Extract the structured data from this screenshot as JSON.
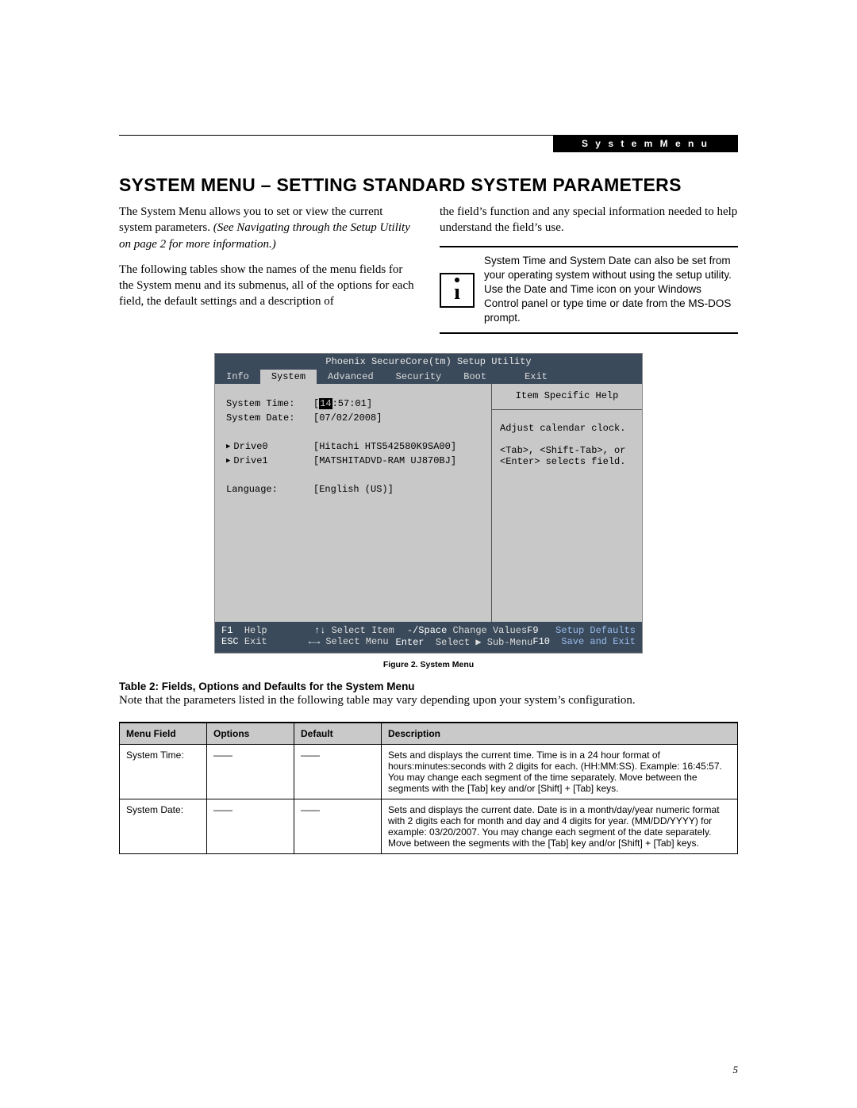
{
  "header": {
    "section_label": "S y s t e m   M e n u"
  },
  "title": "SYSTEM MENU – SETTING STANDARD SYSTEM PARAMETERS",
  "body": {
    "p1a": "The System Menu allows you to set or view the current system parameters. ",
    "p1b": "(See Navigating through the Setup Utility on page 2 for more information.)",
    "p2": "The following tables show the names of the menu fields for the System menu and its submenus, all of the options for each field, the default settings and a description of",
    "p3": "the field’s function and any special information needed to help understand the field’s use.",
    "info": "System Time and System Date can also be set from your operating system without using the setup utility. Use the Date and Time icon on your Windows Control panel or type time or date from the MS-DOS prompt."
  },
  "bios": {
    "title": "Phoenix SecureCore(tm) Setup Utility",
    "tabs": [
      "Info",
      "System",
      "Advanced",
      "Security",
      "Boot",
      "Exit"
    ],
    "active_tab_index": 1,
    "fields": {
      "system_time_label": "System Time:",
      "system_time_value_prefix": "[",
      "system_time_hh": "14",
      "system_time_rest": ":57:01]",
      "system_date_label": "System Date:",
      "system_date_value": "[07/02/2008]",
      "drive0_label": "Drive0",
      "drive0_value": "[Hitachi HTS542580K9SA00]",
      "drive1_label": "Drive1",
      "drive1_value": "[MATSHITADVD-RAM UJ870BJ]",
      "language_label": "Language:",
      "language_value": "[English (US)]"
    },
    "help": {
      "title": "Item Specific Help",
      "line1": "Adjust calendar clock.",
      "line2": "<Tab>, <Shift-Tab>, or",
      "line3": "<Enter> selects field."
    },
    "footer": {
      "f1": "F1",
      "help": "Help",
      "updown": "↑↓",
      "sel_item": "Select Item",
      "minus_space": "-/Space",
      "change_vals": "Change Values",
      "f9": "F9",
      "setup_def": "Setup Defaults",
      "esc": "ESC",
      "exit": "Exit",
      "leftright": "←→",
      "sel_menu": "Select Menu",
      "enter": "Enter",
      "sel_sub": "Select ▶ Sub-Menu",
      "f10": "F10",
      "save_exit": "Save and Exit"
    }
  },
  "figure_caption": "Figure 2.  System Menu",
  "table": {
    "title": "Table 2: Fields, Options and Defaults for the System Menu",
    "note": "Note that the parameters listed in the following table may vary depending upon your system’s configuration.",
    "headers": {
      "c1": "Menu Field",
      "c2": "Options",
      "c3": "Default",
      "c4": "Description"
    },
    "rows": [
      {
        "field": "System Time:",
        "options": "——",
        "default": "——",
        "desc": "Sets and displays the current time. Time is in a 24 hour format of hours:minutes:seconds with 2 digits for each. (HH:MM:SS). Example: 16:45:57. You may change each segment of the time separately. Move between the segments with the [Tab] key and/or [Shift] + [Tab] keys."
      },
      {
        "field": "System Date:",
        "options": "——",
        "default": "——",
        "desc": "Sets and displays the current date. Date is in a month/day/year numeric format with 2 digits each for month and day and 4 digits for year. (MM/DD/YYYY) for example: 03/20/2007. You may change each segment of the date separately. Move between the segments with the [Tab] key and/or [Shift] + [Tab] keys."
      }
    ]
  },
  "page_number": "5"
}
